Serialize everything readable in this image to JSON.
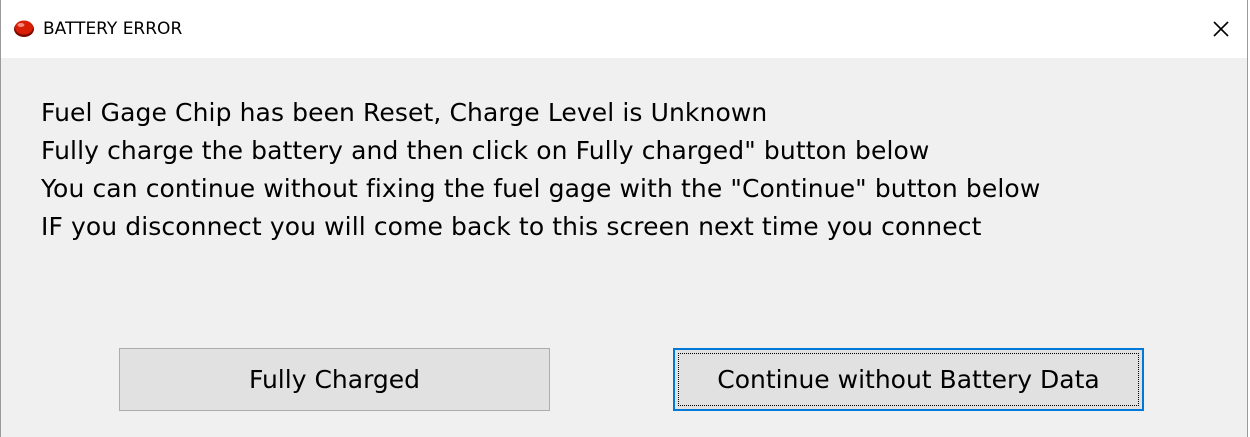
{
  "window": {
    "title": "BATTERY ERROR",
    "icon": "red-stop-icon",
    "close_glyph": "✕"
  },
  "message": {
    "lines": [
      "Fuel Gage Chip has been Reset, Charge Level is Unknown",
      "Fully charge the battery and then click on Fully charged\" button below",
      "You can continue without fixing the fuel gage with the \"Continue\" button below",
      "IF you disconnect you will come back to this screen next time you connect"
    ]
  },
  "buttons": {
    "fully_charged": "Fully Charged",
    "continue": "Continue without Battery Data"
  },
  "colors": {
    "dialog_bg": "#f0f0f0",
    "titlebar_bg": "#ffffff",
    "button_bg": "#e1e1e1",
    "focus_border": "#0078d7",
    "icon_red": "#d81e05"
  }
}
